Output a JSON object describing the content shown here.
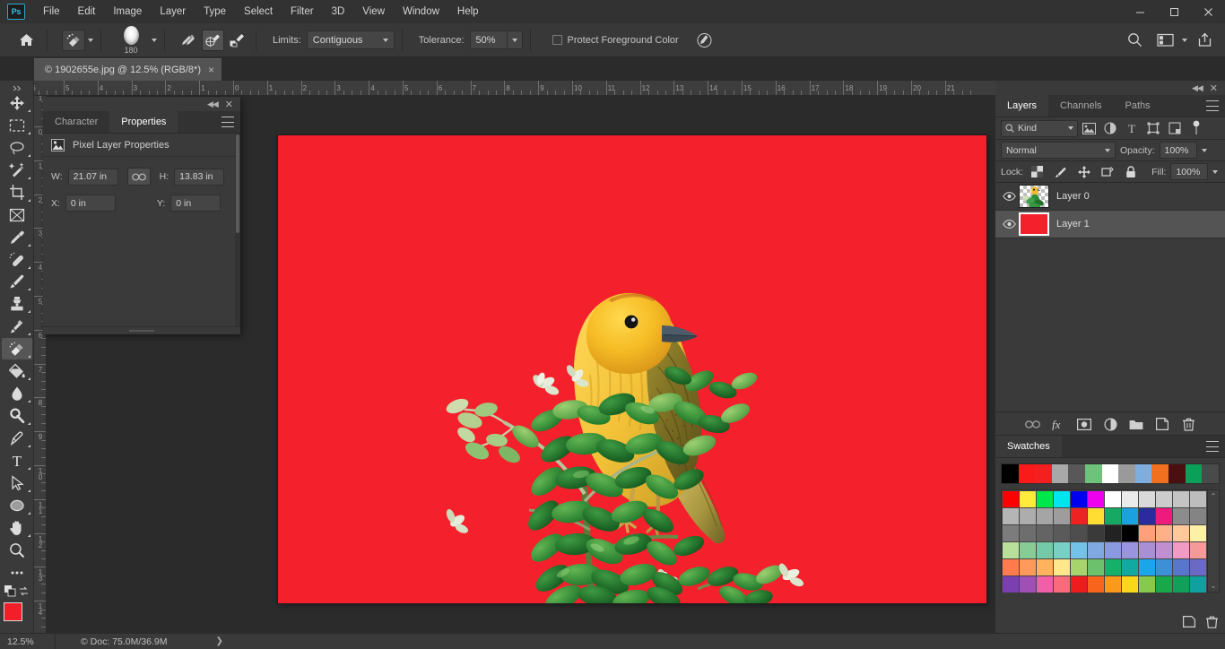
{
  "app": {
    "name": "Ps",
    "logo_color": "#31c4e8"
  },
  "menubar": {
    "items": [
      "File",
      "Edit",
      "Image",
      "Layer",
      "Type",
      "Select",
      "Filter",
      "3D",
      "View",
      "Window",
      "Help"
    ],
    "window_controls": [
      "minimize-icon",
      "maximize-icon",
      "close-icon"
    ]
  },
  "options_bar": {
    "home_icon": "home-icon",
    "tool_preset_icon": "background-eraser-icon",
    "brush_size": "180",
    "sampling_modes": [
      {
        "name": "sampling-continuous",
        "icon": "eyedropper-continuous-icon",
        "active": false
      },
      {
        "name": "sampling-once",
        "icon": "eyedropper-once-icon",
        "active": true
      },
      {
        "name": "sampling-background-swatch",
        "icon": "eyedropper-background-swatch-icon",
        "active": false
      }
    ],
    "limits_label": "Limits:",
    "limits_value": "Contiguous",
    "tolerance_label": "Tolerance:",
    "tolerance_value": "50%",
    "protect_foreground_label": "Protect Foreground Color",
    "protect_foreground_checked": false,
    "pressure_icon": "pressure-size-icon",
    "right_icons": [
      "search-icon",
      "workspace-icon",
      "chevron-down-icon",
      "share-icon"
    ]
  },
  "document_tab": {
    "title": "© 1902655e.jpg @ 12.5% (RGB/8*)",
    "close_label": "×"
  },
  "toolbar": {
    "tools": [
      {
        "name": "move-tool",
        "icon": "move-icon",
        "active": false,
        "has_flyout": true
      },
      {
        "name": "marquee-tool",
        "icon": "rectangular-marquee-icon",
        "active": false,
        "has_flyout": true
      },
      {
        "name": "lasso-tool",
        "icon": "lasso-icon",
        "active": false,
        "has_flyout": true
      },
      {
        "name": "object-selection-tool",
        "icon": "magic-wand-icon",
        "active": false,
        "has_flyout": true
      },
      {
        "name": "crop-tool",
        "icon": "crop-icon",
        "active": false,
        "has_flyout": true
      },
      {
        "name": "frame-tool",
        "icon": "frame-icon",
        "active": false,
        "has_flyout": false
      },
      {
        "name": "eyedropper-tool",
        "icon": "eyedropper-icon",
        "active": false,
        "has_flyout": true
      },
      {
        "name": "spot-healing-tool",
        "icon": "healing-brush-icon",
        "active": false,
        "has_flyout": true
      },
      {
        "name": "brush-tool",
        "icon": "paintbrush-icon",
        "active": false,
        "has_flyout": true
      },
      {
        "name": "clone-stamp-tool",
        "icon": "clone-stamp-icon",
        "active": false,
        "has_flyout": true
      },
      {
        "name": "history-brush-tool",
        "icon": "history-brush-icon",
        "active": false,
        "has_flyout": true
      },
      {
        "name": "eraser-tool",
        "icon": "background-eraser-icon",
        "active": true,
        "has_flyout": true
      },
      {
        "name": "gradient-tool",
        "icon": "paint-bucket-icon",
        "active": false,
        "has_flyout": true
      },
      {
        "name": "blur-tool",
        "icon": "blur-droplet-icon",
        "active": false,
        "has_flyout": true
      },
      {
        "name": "dodge-tool",
        "icon": "dodge-icon",
        "active": false,
        "has_flyout": true
      },
      {
        "name": "pen-tool",
        "icon": "pen-icon",
        "active": false,
        "has_flyout": true
      },
      {
        "name": "type-tool",
        "icon": "type-icon",
        "active": false,
        "has_flyout": true
      },
      {
        "name": "path-selection-tool",
        "icon": "path-arrow-icon",
        "active": false,
        "has_flyout": true
      },
      {
        "name": "ellipse-tool",
        "icon": "ellipse-shape-icon",
        "active": false,
        "has_flyout": true
      },
      {
        "name": "hand-tool",
        "icon": "hand-icon",
        "active": false,
        "has_flyout": true
      },
      {
        "name": "zoom-tool",
        "icon": "zoom-magnifier-icon",
        "active": false,
        "has_flyout": false
      },
      {
        "name": "edit-toolbar-button",
        "icon": "ellipsis-icon",
        "active": false,
        "has_flyout": false
      }
    ],
    "foreground_color": "#f31e27",
    "background_color": "#ffffff",
    "default_colors_icon": "default-colors-icon",
    "swap_colors_icon": "swap-colors-icon"
  },
  "rulers": {
    "unit": "in",
    "horizontal_labels": [
      "6",
      "5",
      "4",
      "3",
      "2",
      "1",
      "0",
      "1",
      "2",
      "3",
      "4",
      "5",
      "6",
      "7",
      "8",
      "9",
      "10",
      "11",
      "12",
      "13",
      "14",
      "15",
      "16",
      "17",
      "18",
      "19",
      "20",
      "21"
    ],
    "vertical_labels": [
      "1",
      "0",
      "1",
      "2",
      "3",
      "4",
      "5",
      "6",
      "7",
      "8",
      "9",
      "10",
      "11",
      "12",
      "13",
      "14"
    ]
  },
  "properties_panel": {
    "tabs": [
      {
        "label": "Character",
        "active": false
      },
      {
        "label": "Properties",
        "active": true
      }
    ],
    "section_title": "Pixel Layer Properties",
    "section_icon": "pixel-layer-icon",
    "fields": [
      {
        "label": "W:",
        "value": "21.07 in",
        "name": "width-field"
      },
      {
        "label": "H:",
        "value": "13.83 in",
        "name": "height-field"
      },
      {
        "label": "X:",
        "value": "0 in",
        "name": "x-field"
      },
      {
        "label": "Y:",
        "value": "0 in",
        "name": "y-field"
      }
    ],
    "link_icon": "link-dimensions-icon",
    "collapse_icon": "collapse-panel-icon",
    "close_icon": "close-panel-icon"
  },
  "layers_panel": {
    "tabs": [
      {
        "label": "Layers",
        "active": true
      },
      {
        "label": "Channels",
        "active": false
      },
      {
        "label": "Paths",
        "active": false
      }
    ],
    "filter_label": "Kind",
    "filter_icons": [
      "pixel-filter-icon",
      "adjustment-filter-icon",
      "type-filter-icon",
      "shape-filter-icon",
      "smart-object-filter-icon"
    ],
    "filter_toggle_icon": "filter-toggle-icon",
    "blend_mode": "Normal",
    "opacity_label": "Opacity:",
    "opacity_value": "100%",
    "lock_label": "Lock:",
    "lock_icons": [
      "lock-transparency-icon",
      "lock-image-icon",
      "lock-position-icon",
      "lock-artboard-icon",
      "lock-all-icon"
    ],
    "fill_label": "Fill:",
    "fill_value": "100%",
    "layers": [
      {
        "name": "Layer 0",
        "visible": true,
        "selected": false,
        "thumb": "bird-thumb"
      },
      {
        "name": "Layer 1",
        "visible": true,
        "selected": true,
        "thumb": "red-thumb",
        "thumb_color": "#f4202c"
      }
    ],
    "footer_icons": [
      "link-layers-icon",
      "layer-style-icon",
      "layer-mask-icon",
      "adjustment-layer-icon",
      "new-group-icon",
      "new-layer-icon",
      "delete-layer-icon"
    ]
  },
  "swatches_panel": {
    "title": "Swatches",
    "recent_colors": [
      "#000000",
      "#f91a1a",
      "#f42020",
      "#a8a8a8",
      "#585858",
      "#6fc27a",
      "#ffffff",
      "#9a9a9a",
      "#7eaedd",
      "#f07020",
      "#4a1010",
      "#0ba05a",
      "#4a4a4a"
    ],
    "grid_colors": [
      "#ff0000",
      "#ffeb3b",
      "#00e64d",
      "#00e5ee",
      "#0000ee",
      "#ee00ee",
      "#ffffff",
      "#ebebeb",
      "#d9d9d9",
      "#cccccc",
      "#c4c4c4",
      "#bdbdbd",
      "#b5b5b5",
      "#adadad",
      "#a5a5a5",
      "#9d9d9d",
      "#ee2222",
      "#ffdd33",
      "#17a864",
      "#1ba0e0",
      "#2b2b9e",
      "#ee1a7e",
      "#8c8c8c",
      "#848484",
      "#7c7c7c",
      "#6e6e6e",
      "#646464",
      "#5a5a5a",
      "#4e4e4e",
      "#3a3a3a",
      "#222222",
      "#000000",
      "#ffa07a",
      "#ffb088",
      "#ffc99a",
      "#fff0a8",
      "#b8e09a",
      "#86cc94",
      "#74c9a6",
      "#79cfc4",
      "#74c2e8",
      "#7fa9e0",
      "#8a9ae0",
      "#9a93dd",
      "#a98fd4",
      "#c18ed0",
      "#f09ac4",
      "#f59a9a",
      "#ff7a4d",
      "#ff9a5c",
      "#ffb35c",
      "#ffe88c",
      "#a8d46e",
      "#6cc26c",
      "#16b06a",
      "#12a9a0",
      "#1aa6e8",
      "#3d8fd6",
      "#5877cc",
      "#6a6ac4",
      "#7a3fb0",
      "#a04fb4",
      "#f05fa8",
      "#f96a7a",
      "#ee1c1c",
      "#f9641c",
      "#f99a1c",
      "#f9d81c",
      "#88c84a",
      "#18a84a",
      "#10a05a",
      "#10a0a0"
    ],
    "scroll_up_icon": "scroll-up-icon",
    "scroll_down_icon": "scroll-down-icon",
    "footer_icons": [
      "new-swatch-icon",
      "delete-swatch-icon"
    ]
  },
  "canvas": {
    "background_color": "#f4202c",
    "subject": "yellow-warbler-bird-on-green-foliage",
    "bird_colors": {
      "head": "#f0b828",
      "breast": "#f3c43a",
      "wing": "#8a7a2a",
      "beak": "#4a5a68",
      "eye": "#1a1a1a",
      "crown": "#d06a20"
    },
    "foliage_colors": {
      "dark": "#1e6b2a",
      "mid": "#2f8a36",
      "light": "#7db85c",
      "pale": "#c8d9a8",
      "stem": "#b8c49a"
    }
  },
  "status_bar": {
    "zoom": "12.5%",
    "doc_info": "© Doc: 75.0M/36.9M",
    "arrow_icon": "chevron-right-icon"
  }
}
